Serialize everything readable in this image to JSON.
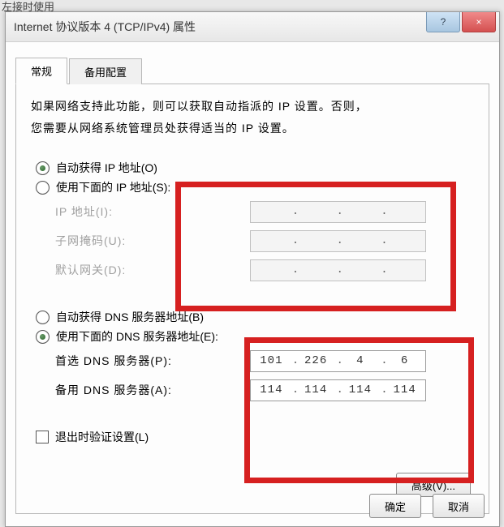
{
  "partial": "左接时使用",
  "window": {
    "title": "Internet 协议版本 4 (TCP/IPv4) 属性",
    "help_glyph": "?",
    "close_glyph": "×"
  },
  "tabs": {
    "general": "常规",
    "alternate": "备用配置"
  },
  "desc_line1": "如果网络支持此功能，则可以获取自动指派的 IP 设置。否则，",
  "desc_line2": "您需要从网络系统管理员处获得适当的 IP 设置。",
  "ip": {
    "auto_label": "自动获得 IP 地址(O)",
    "manual_label": "使用下面的 IP 地址(S):",
    "addr_label": "IP 地址(I):",
    "mask_label": "子网掩码(U):",
    "gw_label": "默认网关(D):",
    "addr": [
      "",
      "",
      "",
      ""
    ],
    "mask": [
      "",
      "",
      "",
      ""
    ],
    "gw": [
      "",
      "",
      "",
      ""
    ]
  },
  "dns": {
    "auto_label": "自动获得 DNS 服务器地址(B)",
    "manual_label": "使用下面的 DNS 服务器地址(E):",
    "pref_label": "首选 DNS 服务器(P):",
    "alt_label": "备用 DNS 服务器(A):",
    "pref": [
      "101",
      "226",
      "4",
      "6"
    ],
    "alt": [
      "114",
      "114",
      "114",
      "114"
    ]
  },
  "validate_label": "退出时验证设置(L)",
  "advanced_label": "高级(V)...",
  "ok_label": "确定",
  "cancel_label": "取消"
}
